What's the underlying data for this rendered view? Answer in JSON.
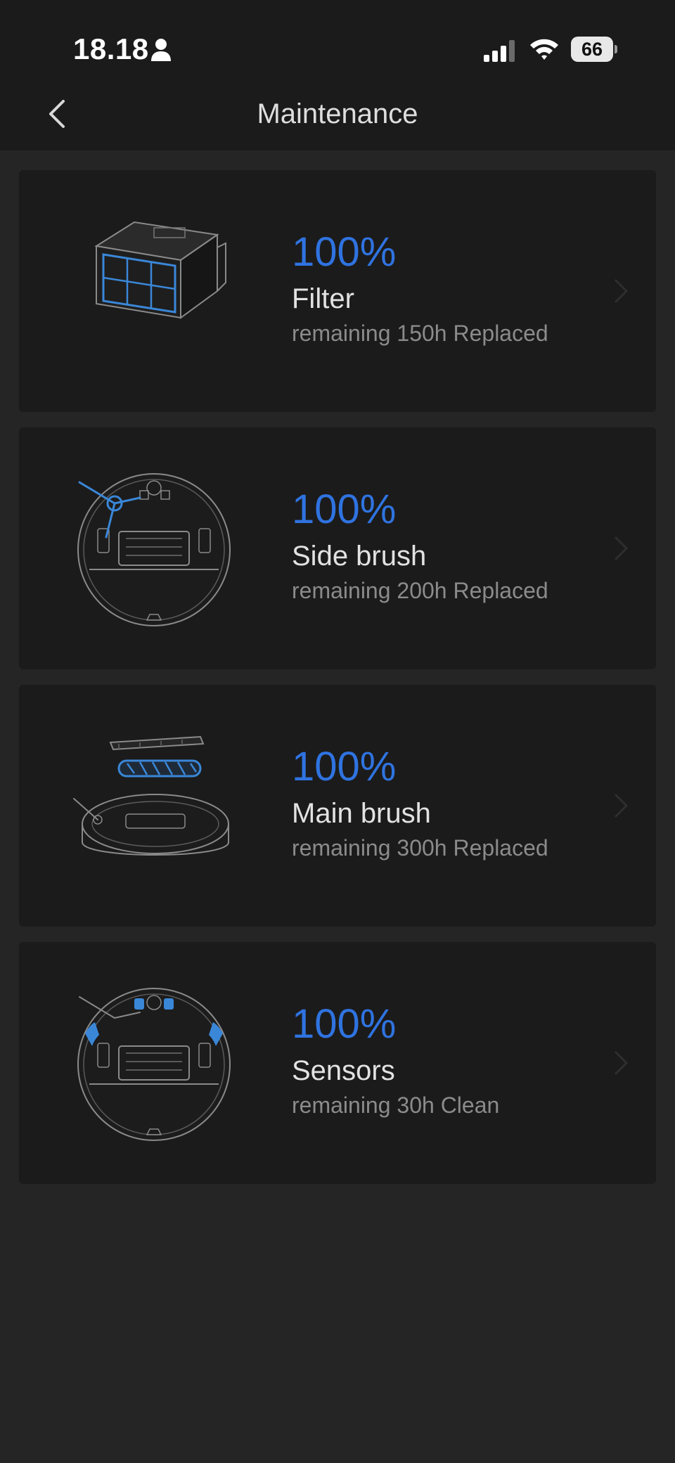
{
  "status_bar": {
    "time": "18.18",
    "battery_level": "66",
    "icons": [
      "person-icon",
      "signal-icon",
      "wifi-icon",
      "battery-icon"
    ]
  },
  "nav": {
    "title": "Maintenance",
    "back_icon": "chevron-left-icon"
  },
  "colors": {
    "background": "#252525",
    "card": "#1b1b1b",
    "accent": "#2f73e0",
    "title_text": "#e2e2e2",
    "secondary_text": "#8b8b8b"
  },
  "items": [
    {
      "percent": "100%",
      "name": "Filter",
      "detail": "remaining 150h Replaced",
      "icon": "filter-illustration"
    },
    {
      "percent": "100%",
      "name": "Side brush",
      "detail": "remaining 200h Replaced",
      "icon": "side-brush-illustration"
    },
    {
      "percent": "100%",
      "name": "Main brush",
      "detail": "remaining 300h Replaced",
      "icon": "main-brush-illustration"
    },
    {
      "percent": "100%",
      "name": "Sensors",
      "detail": "remaining 30h Clean",
      "icon": "sensors-illustration"
    }
  ]
}
